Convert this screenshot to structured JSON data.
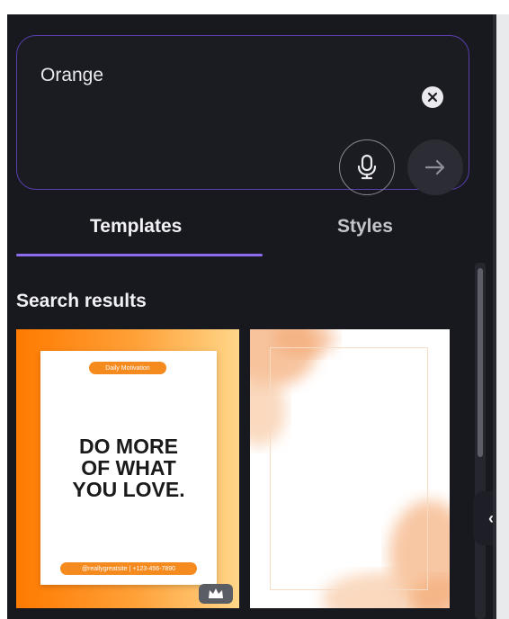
{
  "search": {
    "value": "Orange"
  },
  "tabs": {
    "templates": "Templates",
    "styles": "Styles"
  },
  "results": {
    "title": "Search results",
    "items": [
      {
        "top_pill": "Daily Motivation",
        "headline_1": "DO MORE",
        "headline_2": "OF WHAT",
        "headline_3": "YOU LOVE.",
        "bottom_pill": "@reallygreatsite | +123-456-7890"
      }
    ]
  },
  "colors": {
    "panel_bg": "#18191f",
    "accent": "#8b6cf0",
    "orange": "#ff7a00"
  },
  "icons": {
    "clear": "close-circle-icon",
    "mic": "microphone-icon",
    "go": "arrow-right-icon",
    "crown": "crown-icon",
    "collapse": "chevron-left-icon"
  }
}
